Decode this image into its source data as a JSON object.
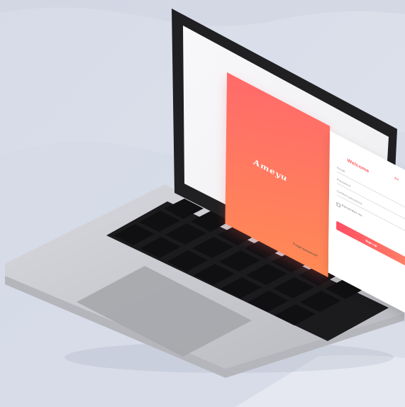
{
  "screen": {
    "brand": "Ameyu",
    "form_title": "Welcome",
    "lang_switch": "En",
    "fields": [
      "Email",
      "Password",
      "Confirm password"
    ],
    "checkbox_label": "Remember me",
    "submit_label": "Sign up",
    "footer_link": "Forgot password?"
  },
  "colors": {
    "accent": "#ff5b63",
    "accent_2": "#ff7d67",
    "laptop_body": "#c7c8cd",
    "screen_bezel": "#1b1b1d",
    "keyboard": "#171719"
  }
}
